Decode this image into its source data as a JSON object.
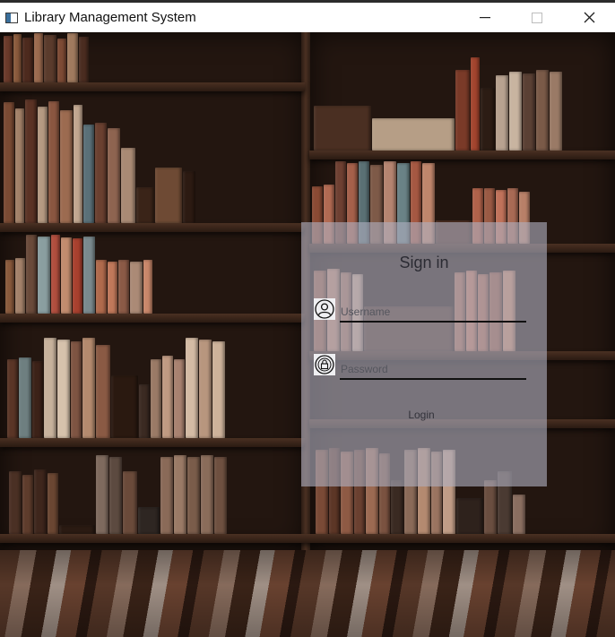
{
  "window": {
    "title": "Library Management System",
    "controls": [
      "minimize",
      "maximize",
      "close"
    ]
  },
  "background": {
    "description_icon": "bookshelf-background"
  },
  "login": {
    "title": "Sign in",
    "username": {
      "placeholder": "Username",
      "value": "",
      "icon": "user-icon"
    },
    "password": {
      "placeholder": "Password",
      "value": "",
      "icon": "lock-icon"
    },
    "login_label": "Login"
  },
  "colors": {
    "panel": "#afafbe",
    "underline": "#111111"
  }
}
